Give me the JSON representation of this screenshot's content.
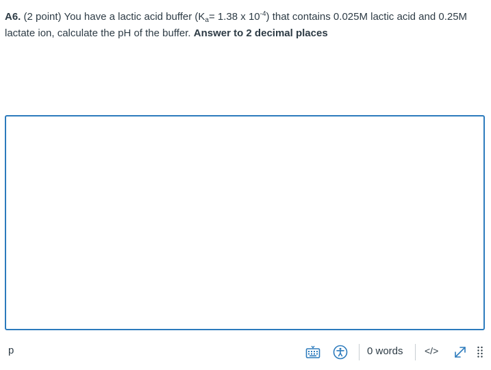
{
  "question": {
    "number": "A6.",
    "points": "(2 point)",
    "text_before_k": "You have a lactic acid buffer (K",
    "k_subscript": "a",
    "text_after_k": "= 1.38 x 10",
    "exponent": "-4",
    "text_after_exp": ") that contains 0.025M lactic acid and 0.25M lactate ion, calculate the pH of the buffer.",
    "emphasis": "Answer to 2 decimal places"
  },
  "editor": {
    "content": ""
  },
  "statusbar": {
    "path": "p",
    "word_count": "0 words",
    "html_toggle": "</>"
  },
  "icons": {
    "keyboard": "keyboard-icon",
    "accessibility": "accessibility-icon",
    "expand": "expand-icon",
    "drag": "drag-handle-icon"
  },
  "colors": {
    "accent": "#2b7abc",
    "text": "#2d3b45",
    "icon_blue": "#2b7abc"
  }
}
